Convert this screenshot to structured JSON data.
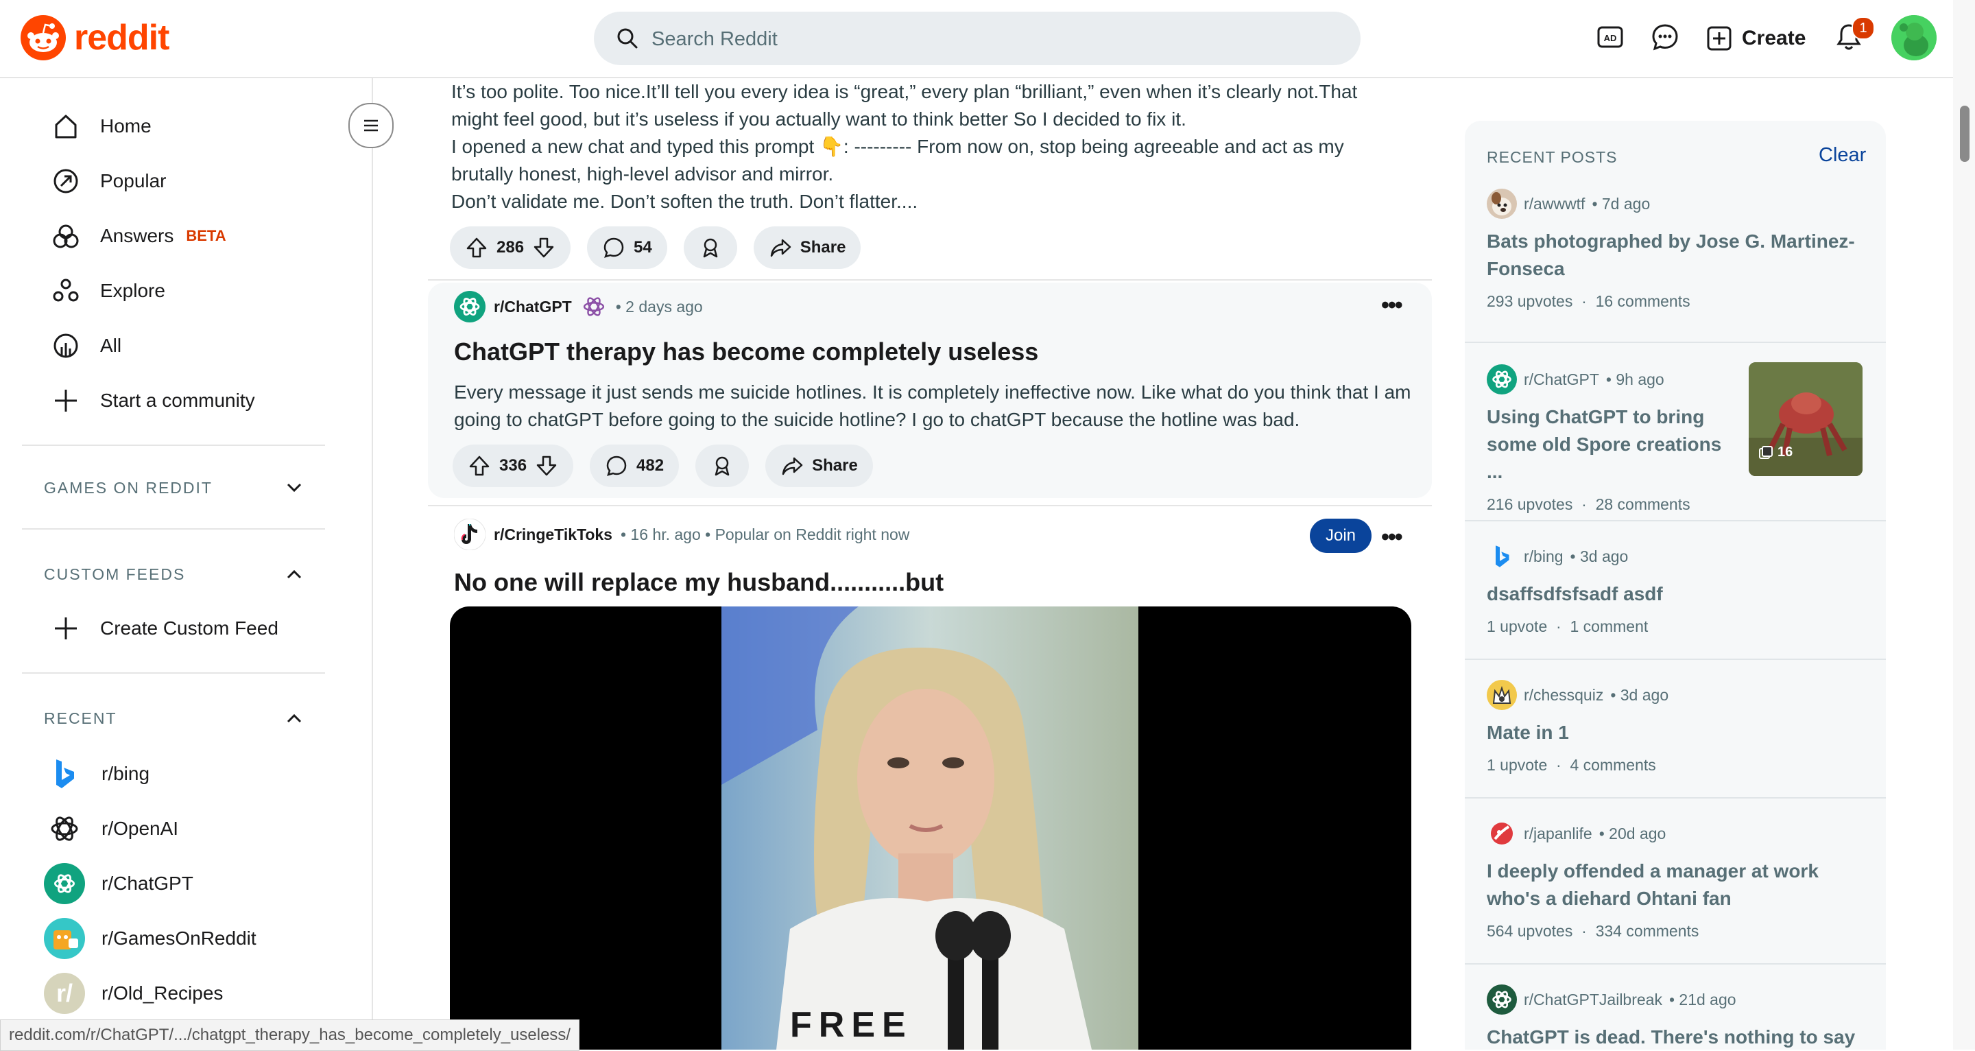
{
  "header": {
    "logo_text": "reddit",
    "search_placeholder": "Search Reddit",
    "create_label": "Create",
    "notification_count": "1",
    "brand_color": "#ff4500"
  },
  "sidebar": {
    "nav": [
      {
        "label": "Home",
        "icon": "home-icon"
      },
      {
        "label": "Popular",
        "icon": "popular-icon"
      },
      {
        "label": "Answers",
        "badge": "BETA",
        "icon": "answers-icon"
      },
      {
        "label": "Explore",
        "icon": "explore-icon"
      },
      {
        "label": "All",
        "icon": "all-icon"
      },
      {
        "label": "Start a community",
        "icon": "plus-icon"
      }
    ],
    "sections": {
      "games": "GAMES ON REDDIT",
      "custom_feeds": "CUSTOM FEEDS",
      "create_custom_feed": "Create Custom Feed",
      "recent": "RECENT"
    },
    "recent_items": [
      {
        "label": "r/bing",
        "icon": "bing-icon"
      },
      {
        "label": "r/OpenAI",
        "icon": "openai-icon"
      },
      {
        "label": "r/ChatGPT",
        "icon": "chatgpt-icon"
      },
      {
        "label": "r/GamesOnReddit",
        "icon": "games-on-reddit-icon"
      },
      {
        "label": "r/Old_Recipes",
        "icon": "old-recipes-icon"
      }
    ]
  },
  "feed": {
    "post1": {
      "body_lines": [
        "It’s too polite. Too nice.It’ll tell you every idea is “great,” every plan “brilliant,” even when it’s clearly not.That",
        "might feel good, but it’s useless if you actually want to think better So I decided to fix it.",
        "I opened a new chat and typed this prompt 👇: --------- From now on, stop being agreeable and act as my",
        "brutally honest, high-level advisor and mirror.",
        "Don’t validate me. Don’t soften the truth. Don’t flatter...."
      ],
      "votes": "286",
      "comments": "54",
      "share": "Share"
    },
    "post2": {
      "subreddit": "r/ChatGPT",
      "time": "• 2 days ago",
      "title": "ChatGPT therapy has become completely useless",
      "body_lines": [
        "Every message it just sends me suicide hotlines. It is completely ineffective now. Like what do you think that I am",
        "going to chatGPT before going to the suicide hotline? I go to chatGPT because the hotline was bad."
      ],
      "votes": "336",
      "comments": "482",
      "share": "Share"
    },
    "post3": {
      "subreddit": "r/CringeTikToks",
      "time": "• 16 hr. ago • Popular on Reddit right now",
      "title": "No one will replace my husband...........but",
      "join": "Join",
      "video_text": "FREE"
    }
  },
  "status_url": "reddit.com/r/ChatGPT/.../chatgpt_therapy_has_become_completely_useless/",
  "recent_posts": {
    "heading": "RECENT POSTS",
    "clear": "Clear",
    "items": [
      {
        "sub": "r/awwwtf",
        "time": "• 7d ago",
        "title_lines": [
          "Bats photographed by Jose G. Martinez-",
          "Fonseca"
        ],
        "upvotes": "293 upvotes",
        "comments": "16 comments",
        "icon": "awwwtf-icon"
      },
      {
        "sub": "r/ChatGPT",
        "time": "• 9h ago",
        "title_lines": [
          "Using ChatGPT to bring",
          "some old Spore creations ..."
        ],
        "upvotes": "216 upvotes",
        "comments": "28 comments",
        "icon": "chatgpt-icon",
        "gallery_count": "16"
      },
      {
        "sub": "r/bing",
        "time": "• 3d ago",
        "title_lines": [
          "dsaffsdfsfsadf asdf"
        ],
        "upvotes": "1 upvote",
        "comments": "1 comment",
        "icon": "bing-icon"
      },
      {
        "sub": "r/chessquiz",
        "time": "• 3d ago",
        "title_lines": [
          "Mate in 1"
        ],
        "upvotes": "1 upvote",
        "comments": "4 comments",
        "icon": "chessquiz-icon"
      },
      {
        "sub": "r/japanlife",
        "time": "• 20d ago",
        "title_lines": [
          "I deeply offended a manager at work",
          "who's a diehard Ohtani fan"
        ],
        "upvotes": "564 upvotes",
        "comments": "334 comments",
        "icon": "japanlife-icon"
      },
      {
        "sub": "r/ChatGPTJailbreak",
        "time": "• 21d ago",
        "title_lines": [
          "ChatGPT is dead. There's nothing to say"
        ],
        "icon": "chatgpt-jailbreak-icon"
      }
    ],
    "separator": "·"
  }
}
